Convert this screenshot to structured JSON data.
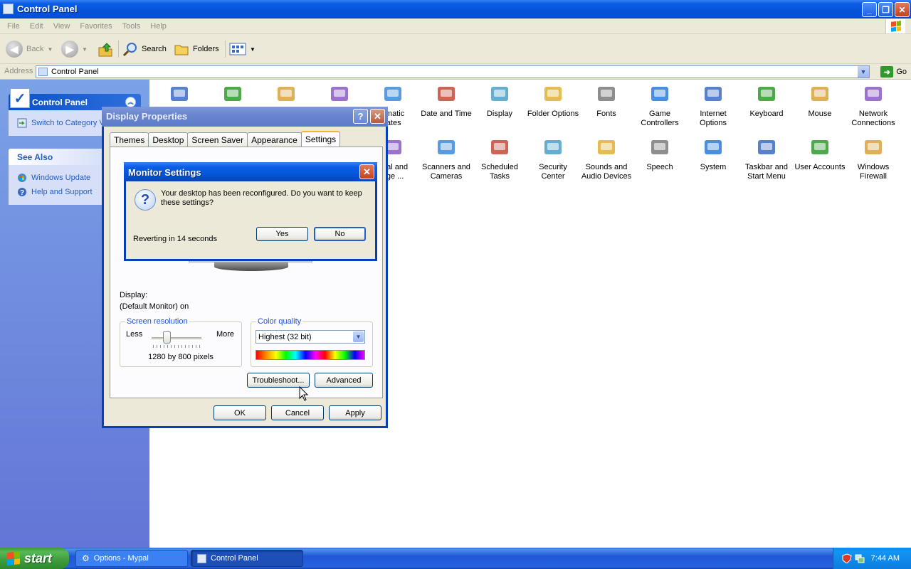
{
  "window": {
    "title": "Control Panel"
  },
  "menu": [
    "File",
    "Edit",
    "View",
    "Favorites",
    "Tools",
    "Help"
  ],
  "toolbar": {
    "back": "Back",
    "search": "Search",
    "folders": "Folders"
  },
  "address": {
    "label": "Address",
    "value": "Control Panel",
    "go": "Go"
  },
  "sidebar": {
    "panel_title": "Control Panel",
    "switch_link": "Switch to Category View",
    "see_also_title": "See Also",
    "see_also": [
      "Windows Update",
      "Help and Support"
    ]
  },
  "icons_row1": [
    {
      "label": "",
      "icon": "accessibility-icon"
    },
    {
      "label": "",
      "icon": "add-hardware-icon"
    },
    {
      "label": "",
      "icon": "add-remove-programs-icon"
    },
    {
      "label": "",
      "icon": "admin-tools-icon"
    },
    {
      "label": "omatic\nlates",
      "icon": "automatic-updates-icon"
    },
    {
      "label": "Date and Time",
      "icon": "date-time-icon"
    },
    {
      "label": "Display",
      "icon": "display-icon"
    },
    {
      "label": "Folder Options",
      "icon": "folder-options-icon"
    },
    {
      "label": "Fonts",
      "icon": "fonts-icon"
    },
    {
      "label": "Game\nControllers",
      "icon": "game-controllers-icon"
    },
    {
      "label": "Internet\nOptions",
      "icon": "internet-options-icon"
    },
    {
      "label": "Keyboard",
      "icon": "keyboard-icon"
    },
    {
      "label": "Mouse",
      "icon": "mouse-icon"
    },
    {
      "label": "Network\nConnections",
      "icon": "network-connections-icon"
    }
  ],
  "icons_row2": [
    {
      "label": "onal and\nage ...",
      "icon": "regional-language-icon"
    },
    {
      "label": "Scanners and\nCameras",
      "icon": "scanners-cameras-icon"
    },
    {
      "label": "Scheduled\nTasks",
      "icon": "scheduled-tasks-icon"
    },
    {
      "label": "Security\nCenter",
      "icon": "security-center-icon"
    },
    {
      "label": "Sounds and\nAudio Devices",
      "icon": "sounds-audio-icon"
    },
    {
      "label": "Speech",
      "icon": "speech-icon"
    },
    {
      "label": "System",
      "icon": "system-icon"
    },
    {
      "label": "Taskbar and\nStart Menu",
      "icon": "taskbar-start-menu-icon"
    },
    {
      "label": "User Accounts",
      "icon": "user-accounts-icon"
    },
    {
      "label": "Windows\nFirewall",
      "icon": "windows-firewall-icon"
    }
  ],
  "display_props": {
    "title": "Display Properties",
    "tabs": [
      "Themes",
      "Desktop",
      "Screen Saver",
      "Appearance",
      "Settings"
    ],
    "active_tab": "Settings",
    "display_label": "Display:",
    "display_value": "(Default Monitor) on",
    "resolution_legend": "Screen resolution",
    "less": "Less",
    "more": "More",
    "resolution_value": "1280 by 800 pixels",
    "color_legend": "Color quality",
    "color_value": "Highest (32 bit)",
    "troubleshoot": "Troubleshoot...",
    "advanced": "Advanced",
    "ok": "OK",
    "cancel": "Cancel",
    "apply": "Apply"
  },
  "monitor_settings": {
    "title": "Monitor Settings",
    "message": "Your desktop has been reconfigured.  Do you want to keep these settings?",
    "countdown": "Reverting in 14 seconds",
    "yes": "Yes",
    "no": "No"
  },
  "taskbar": {
    "start": "start",
    "tasks": [
      "Options - Mypal",
      "Control Panel"
    ],
    "clock": "7:44 AM"
  }
}
